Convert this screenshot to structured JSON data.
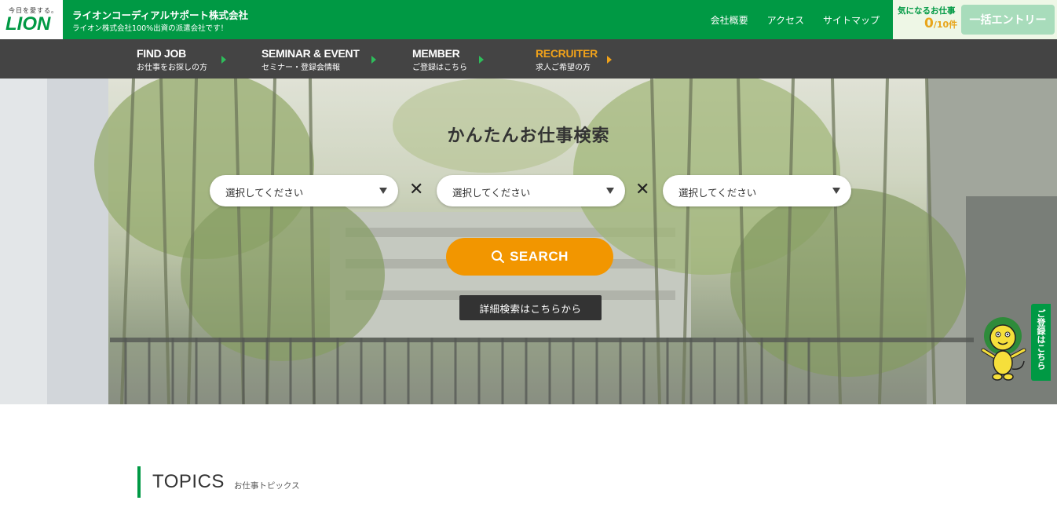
{
  "header": {
    "logo_tagline": "今日を愛する。",
    "logo_word": "LION",
    "company_name": "ライオンコーディアルサポート株式会社",
    "company_sub": "ライオン株式会社100%出資の派遣会社です！",
    "links": [
      "会社概要",
      "アクセス",
      "サイトマップ"
    ],
    "favorites_label": "気になるお仕事",
    "favorites_count": "0",
    "favorites_max": "/10件",
    "entry_button": "一括エントリー"
  },
  "nav": {
    "items": [
      {
        "en": "FIND JOB",
        "jp": "お仕事をお探しの方"
      },
      {
        "en": "SEMINAR & EVENT",
        "jp": "セミナー・登録会情報"
      },
      {
        "en": "MEMBER",
        "jp": "ご登録はこちら"
      },
      {
        "en": "RECRUITER",
        "jp": "求人ご希望の方"
      }
    ]
  },
  "hero": {
    "title": "かんたんお仕事検索",
    "selects": [
      "選択してください",
      "選択してください",
      "選択してください"
    ],
    "times_symbol": "✕",
    "search_button": "SEARCH",
    "detail_button": "詳細検索はこちらから"
  },
  "register_tab": {
    "label": "ご登録はこちら"
  },
  "topics": {
    "title_en": "TOPICS",
    "title_jp": "お仕事トピックス"
  },
  "colors": {
    "brand_green": "#009944",
    "nav_bg": "#444444",
    "accent_orange": "#f29600",
    "recruiter_orange": "#f0a21a",
    "entry_button_bg": "#a8dcbb"
  },
  "icons": [
    "search-icon",
    "caret-down-icon",
    "nav-arrow-icon",
    "lion-mascot-icon"
  ]
}
